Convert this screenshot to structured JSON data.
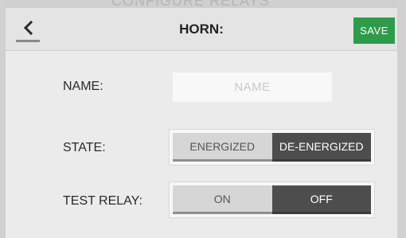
{
  "bezel": {
    "background_text": "CONFIGURE RELAYS"
  },
  "header": {
    "title": "HORN:",
    "back_icon": "chevron-left-icon",
    "save_label": "SAVE",
    "save_color": "#2e9b4b"
  },
  "form": {
    "name": {
      "label": "NAME:",
      "value": "",
      "placeholder": "NAME"
    },
    "state": {
      "label": "STATE:",
      "options": [
        "ENERGIZED",
        "DE-ENERGIZED"
      ],
      "selected": "DE-ENERGIZED"
    },
    "test_relay": {
      "label": "TEST RELAY:",
      "options": [
        "ON",
        "OFF"
      ],
      "selected": "OFF"
    }
  },
  "colors": {
    "active_segment": "#4d4d4d",
    "inactive_segment": "#d6d6d6"
  }
}
